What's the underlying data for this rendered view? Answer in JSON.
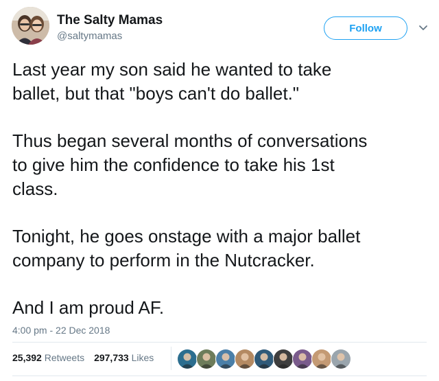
{
  "author": {
    "name": "The Salty Mamas",
    "handle": "@saltymamas",
    "avatar_icon": "profile-photo-two-women"
  },
  "follow_button": {
    "label": "Follow",
    "color": "#1da1f2"
  },
  "menu": {
    "icon": "chevron-down-icon"
  },
  "tweet": {
    "paragraphs": [
      "Last year my son said he wanted to take\nballet, but that \"boys can't do ballet.\"",
      "Thus began several months of conversations\nto give him the confidence to take his 1st\nclass.",
      "Tonight, he goes onstage with a major ballet\ncompany to perform in the Nutcracker.",
      "And I am proud AF."
    ],
    "timestamp": "4:00 pm - 22 Dec 2018"
  },
  "stats": {
    "retweets_count": "25,392",
    "retweets_label": "Retweets",
    "likes_count": "297,733",
    "likes_label": "Likes"
  },
  "likers": [
    {
      "icon": "liker-avatar-1",
      "color": "#2c6e8f"
    },
    {
      "icon": "liker-avatar-2",
      "color": "#6d7c5a"
    },
    {
      "icon": "liker-avatar-3",
      "color": "#4a7fa8"
    },
    {
      "icon": "liker-avatar-4",
      "color": "#b48a62"
    },
    {
      "icon": "liker-avatar-5",
      "color": "#2f5a79"
    },
    {
      "icon": "liker-avatar-6",
      "color": "#3e3e3e"
    },
    {
      "icon": "liker-avatar-7",
      "color": "#7a5b8c"
    },
    {
      "icon": "liker-avatar-8",
      "color": "#c49a74"
    },
    {
      "icon": "liker-avatar-9",
      "color": "#9aa5ad"
    }
  ]
}
